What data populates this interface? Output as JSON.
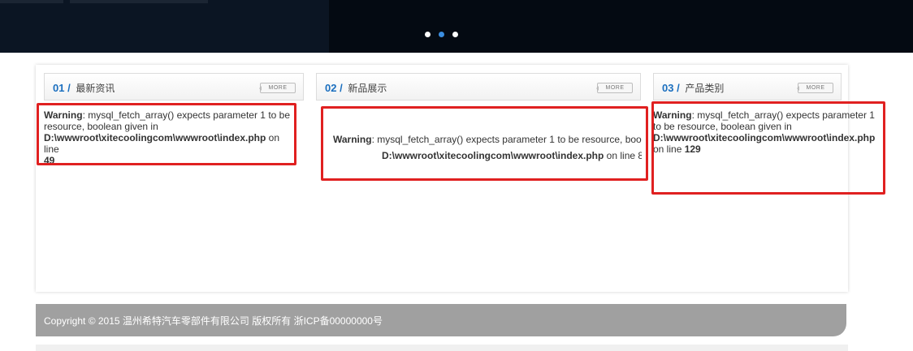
{
  "hero": {
    "slider_dots": [
      {
        "active": false
      },
      {
        "active": true
      },
      {
        "active": false
      }
    ],
    "active_dot_color": "#3b8ee0"
  },
  "columns": [
    {
      "num": "01",
      "sep": "/",
      "title": "最新资讯",
      "more": "MORE"
    },
    {
      "num": "02",
      "sep": "/",
      "title": "新品展示",
      "more": "MORE"
    },
    {
      "num": "03",
      "sep": "/",
      "title": "产品类别",
      "more": "MORE"
    }
  ],
  "warnings": {
    "w1": {
      "label": "Warning",
      "message": ": mysql_fetch_array() expects parameter 1 to be resource, boolean given in",
      "path": "D:\\wwwroot\\xitecoolingcom\\wwwroot\\index.php",
      "on_line": " on line",
      "line": "49"
    },
    "w2": {
      "label": "Warning",
      "message": ": mysql_fetch_array() expects parameter 1 to be resource, boo",
      "path": "D:\\wwwroot\\xitecoolingcom\\wwwroot\\index.php",
      "on_line": " on line 8"
    },
    "w3": {
      "label": "Warning",
      "message": ": mysql_fetch_array() expects parameter 1 to be resource, boolean given in",
      "path": "D:\\wwwroot\\xitecoolingcom\\wwwroot\\index.php",
      "on_line": " on line ",
      "line": "129"
    }
  },
  "highlight_color": "#e02020",
  "footer": {
    "copyright": "Copyright © 2015 温州希特汽车零部件有限公司 版权所有 浙ICP备00000000号"
  }
}
